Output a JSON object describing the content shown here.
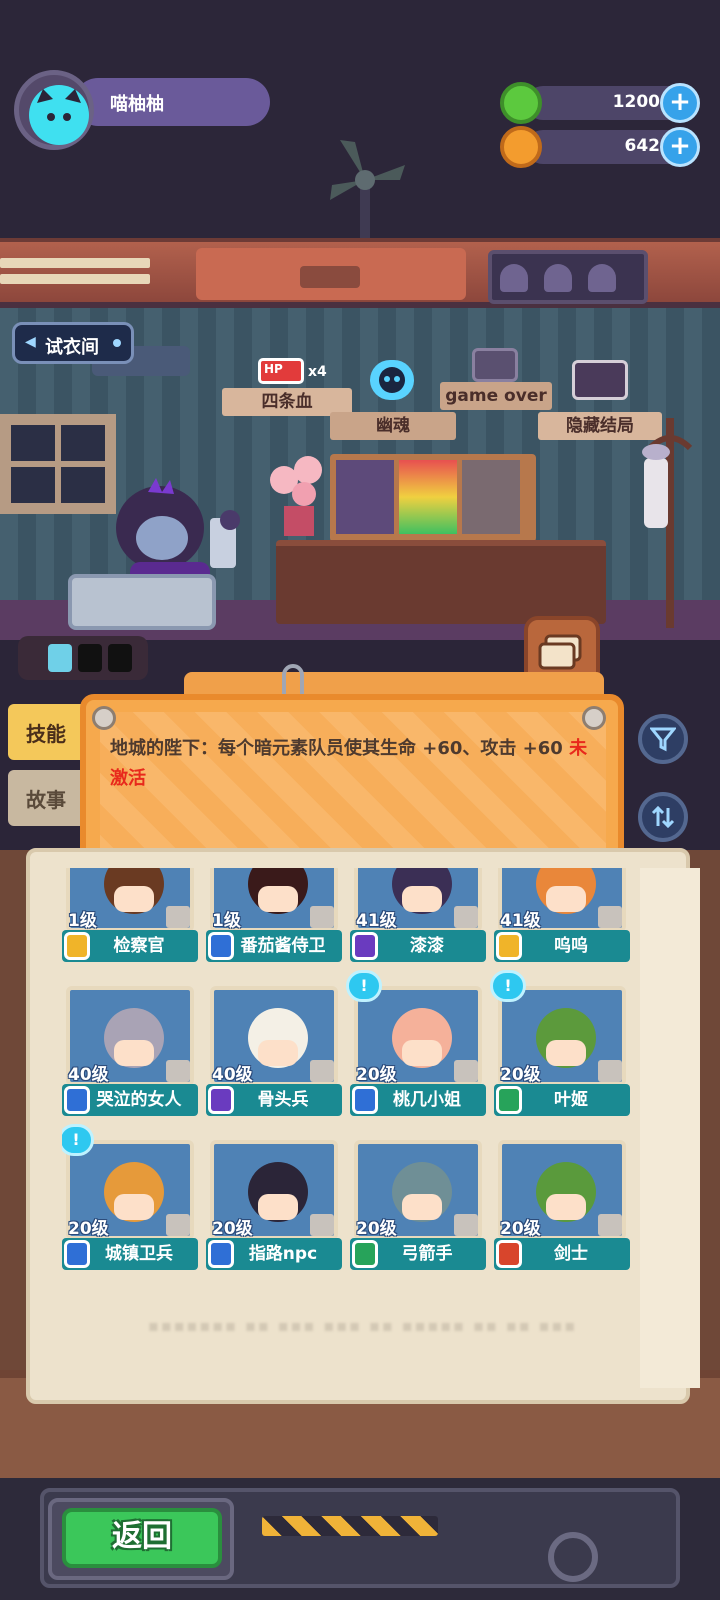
{
  "profile": {
    "name": "喵柚柚"
  },
  "currencies": [
    {
      "icon": "green-donut-coin-icon",
      "value": "1200",
      "color": "#5cc93e"
    },
    {
      "icon": "orange-planet-coin-icon",
      "value": "642",
      "color": "#f39c2e"
    }
  ],
  "room": {
    "fitting_room_label": "试衣间"
  },
  "endings": [
    {
      "label": "四条血",
      "icon": "hp-battery-icon",
      "badge": "x4",
      "hp": "HP"
    },
    {
      "label": "幽魂",
      "icon": "ghost-skull-icon"
    },
    {
      "label": "隐藏结局",
      "icon": "tv-portrait-icon"
    }
  ],
  "game_over_label": "game over",
  "tabs": {
    "skill": "技能",
    "story": "故事"
  },
  "skill_description": {
    "text": "地城的陛下：每个暗元素队员使其生命 +60、攻击 +60 ",
    "status": "未激活",
    "status_color": "#e8291c"
  },
  "heroes": [
    {
      "level": "1级",
      "name": "检察官",
      "badge_color": "#f0b429",
      "art_color": "#4f82b5",
      "hair": "#6a3a22",
      "alert": false
    },
    {
      "level": "1级",
      "name": "番茄酱侍卫",
      "badge_color": "#2f6fd6",
      "art_color": "#4f82b5",
      "hair": "#3a1a1a",
      "alert": false
    },
    {
      "level": "41级",
      "name": "漆漆",
      "badge_color": "#6a3bbf",
      "art_color": "#4f82b5",
      "hair": "#3b2f55",
      "alert": false
    },
    {
      "level": "41级",
      "name": "呜呜",
      "badge_color": "#f0b429",
      "art_color": "#4f82b5",
      "hair": "#e9873a",
      "alert": false
    },
    {
      "level": "40级",
      "name": "哭泣的女人",
      "badge_color": "#2f6fd6",
      "art_color": "#4f82b5",
      "hair": "#a9a3b5",
      "alert": false
    },
    {
      "level": "40级",
      "name": "骨头兵",
      "badge_color": "#6a3bbf",
      "art_color": "#4f82b5",
      "hair": "#f4f0e6",
      "alert": false
    },
    {
      "level": "20级",
      "name": "桃几小姐",
      "badge_color": "#2f6fd6",
      "art_color": "#4f82b5",
      "hair": "#f5b19a",
      "alert": true
    },
    {
      "level": "20级",
      "name": "叶姬",
      "badge_color": "#27a35a",
      "art_color": "#4f82b5",
      "hair": "#5c9a3c",
      "alert": true
    },
    {
      "level": "20级",
      "name": "城镇卫兵",
      "badge_color": "#2f6fd6",
      "art_color": "#4f82b5",
      "hair": "#e69a3a",
      "alert": true
    },
    {
      "level": "20级",
      "name": "指路npc",
      "badge_color": "#2f6fd6",
      "art_color": "#4f82b5",
      "hair": "#2b2538",
      "alert": false
    },
    {
      "level": "20级",
      "name": "弓箭手",
      "badge_color": "#27a35a",
      "art_color": "#4f82b5",
      "hair": "#6f8f96",
      "alert": false
    },
    {
      "level": "20级",
      "name": "剑士",
      "badge_color": "#d8452c",
      "art_color": "#4f82b5",
      "hair": "#5a9a3c",
      "alert": false
    }
  ],
  "buttons": {
    "back": "返回"
  }
}
